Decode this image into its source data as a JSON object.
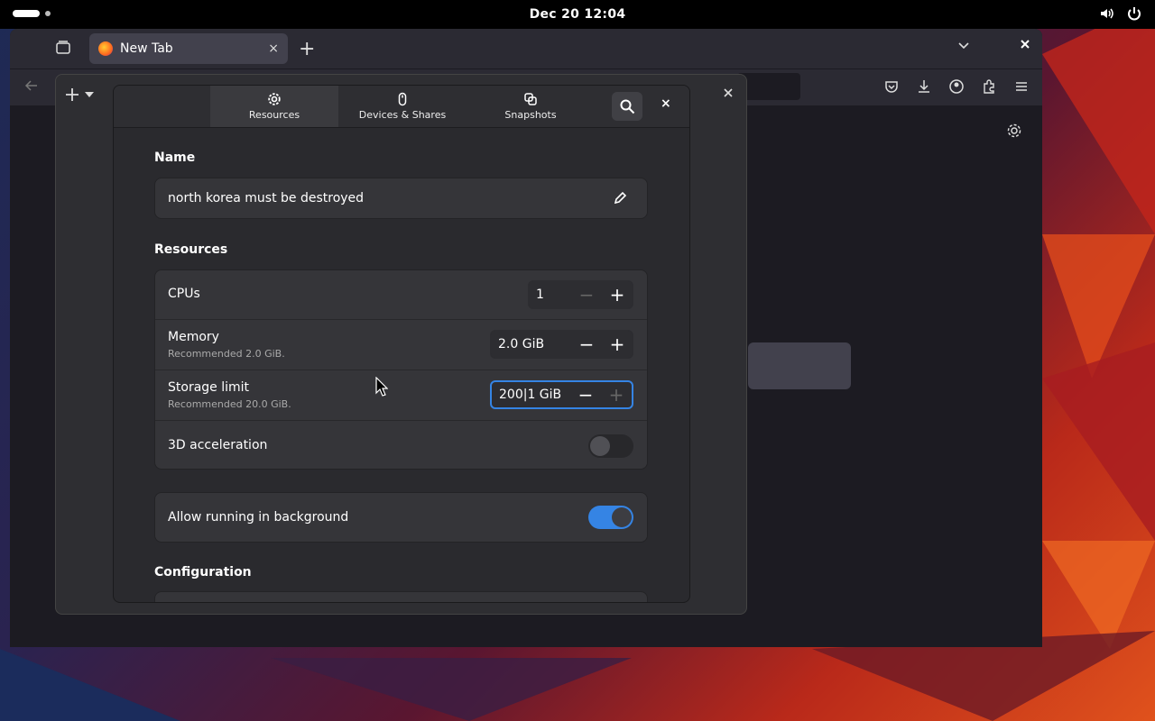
{
  "topbar": {
    "clock": "Dec 20  12:04"
  },
  "browser": {
    "tab_title": "New Tab",
    "tab_close": "×",
    "new_tab": "+"
  },
  "dialog": {
    "tabs": [
      {
        "label": "Resources",
        "icon": "gear-icon"
      },
      {
        "label": "Devices & Shares",
        "icon": "mouse-icon"
      },
      {
        "label": "Snapshots",
        "icon": "snapshots-icon"
      }
    ],
    "close": "×",
    "name_section": "Name",
    "name_value": "north korea must be destroyed",
    "resources_section": "Resources",
    "cpus": {
      "label": "CPUs",
      "value": "1"
    },
    "memory": {
      "label": "Memory",
      "sub": "Recommended 2.0 GiB.",
      "value": "2.0 GiB"
    },
    "storage": {
      "label": "Storage limit",
      "sub": "Recommended 20.0 GiB.",
      "value": "200|1 GiB"
    },
    "accel": {
      "label": "3D acceleration",
      "on": false
    },
    "background": {
      "label": "Allow running in background",
      "on": true
    },
    "config_section": "Configuration",
    "minus": "−",
    "plus": "+"
  },
  "colors": {
    "accent": "#3584e4"
  }
}
